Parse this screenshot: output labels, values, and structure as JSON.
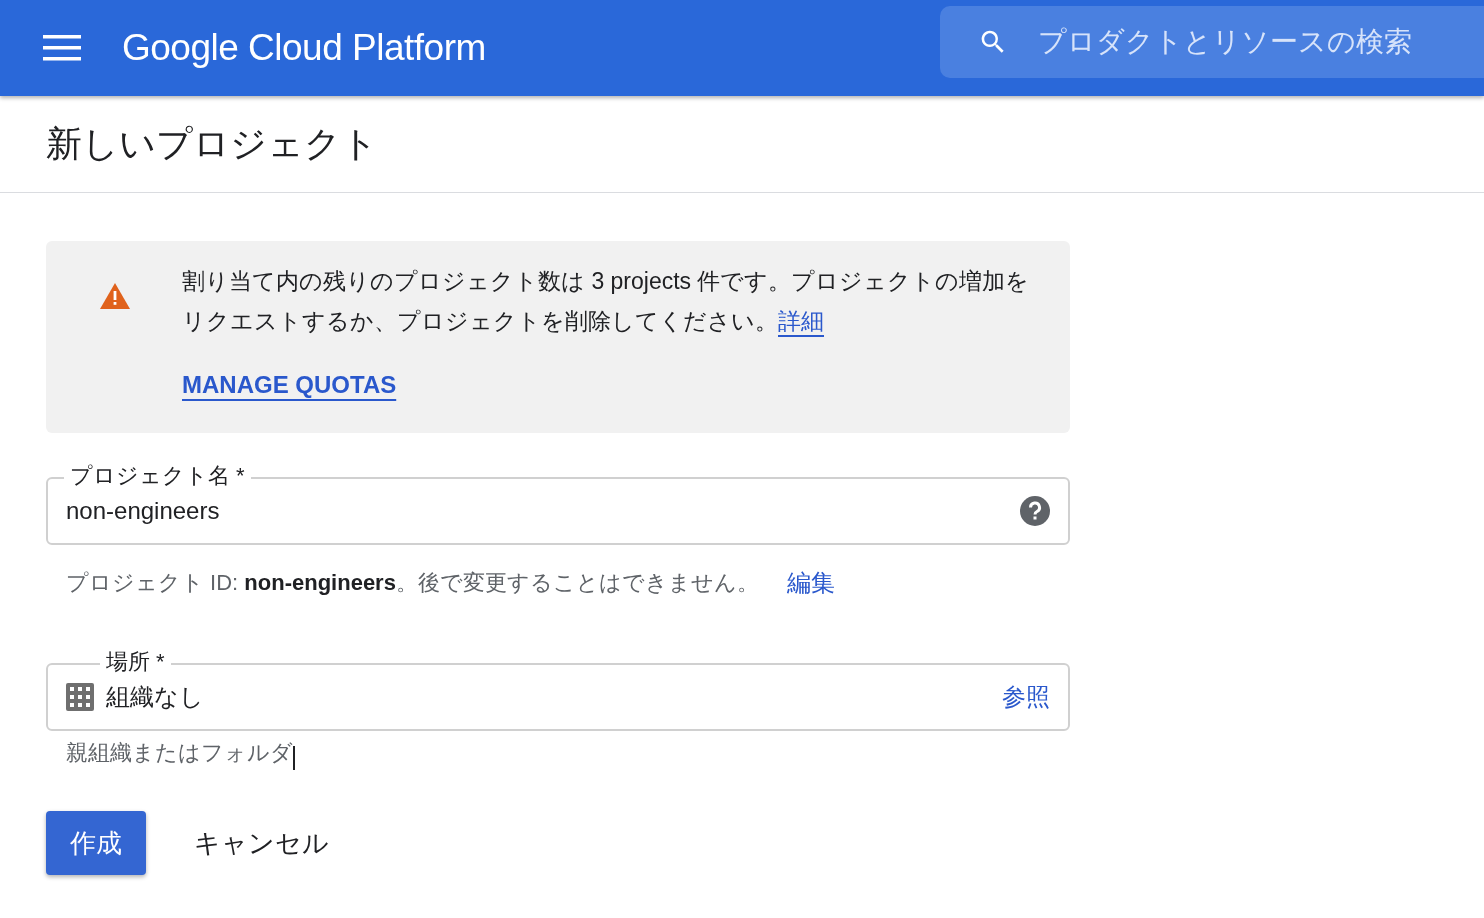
{
  "header": {
    "title": "Google Cloud Platform",
    "search": {
      "placeholder": "プロダクトとリソースの検索"
    }
  },
  "page_title": "新しいプロジェクト",
  "notice": {
    "text": "割り当て内の残りのプロジェクト数は 3 projects 件です。プロジェクトの増加をリクエストするか、プロジェクトを削除してください。",
    "link": "詳細",
    "action": "MANAGE QUOTAS"
  },
  "project_name": {
    "label": "プロジェクト名 *",
    "value": "non-engineers"
  },
  "project_id": {
    "text": "プロジェクト ID: **non-engineers**。後で変更することはできません。",
    "edit": "編集"
  },
  "location": {
    "label": "場所 *",
    "value": "組織なし",
    "browse": "参照",
    "hint": "親組織またはフォルダ"
  },
  "buttons": [
    {
      "label": "作成",
      "kind": "primary"
    },
    {
      "label": "キャンセル",
      "kind": "text"
    }
  ]
}
